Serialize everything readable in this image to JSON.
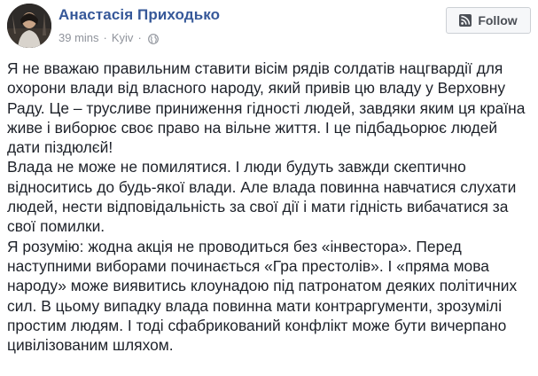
{
  "author": {
    "name": "Анастасія Приходько"
  },
  "meta": {
    "time": "39 mins",
    "separator": "·",
    "location": "Kyiv",
    "separator2": "·",
    "privacy_icon": "globe-icon"
  },
  "follow": {
    "label": "Follow",
    "icon": "rss-icon"
  },
  "post": {
    "lines": [
      "Я не вважаю правильним ставити вісім рядів солдатів нацгвардії для",
      "охорони влади від власного народу, який привів цю владу у Верховну",
      "Раду. Це – трусливе приниження гідності людей, завдяки яким ця країна",
      "живе і виборює своє право на вільне життя. І це підбадьорює людей",
      "дати піздюлєй!",
      "Влада не може не помилятися. І люди будуть завжди скептично",
      "відноситись до будь-якої влади. Але влада повинна навчатися слухати",
      "людей, нести відповідальність за свої дії і мати гідність вибачатися за",
      "свої помилки.",
      "Я розумію: жодна акція не проводиться без «інвестора». Перед",
      "наступними виборами починається «Гра престолів». І «пряма мова",
      "народу» може виявитись клоунадою під патронатом деяких політичних",
      "сил. В цьому випадку влада повинна мати контраргументи, зрозумілі",
      "простим людям. І тоді сфабрикований конфлікт може бути вичерпано",
      "цивілізованим шляхом."
    ]
  },
  "colors": {
    "author": "#365899",
    "meta": "#90949c",
    "text": "#1d2129",
    "button_bg": "#f6f7f9",
    "button_border": "#ccd0d5"
  }
}
